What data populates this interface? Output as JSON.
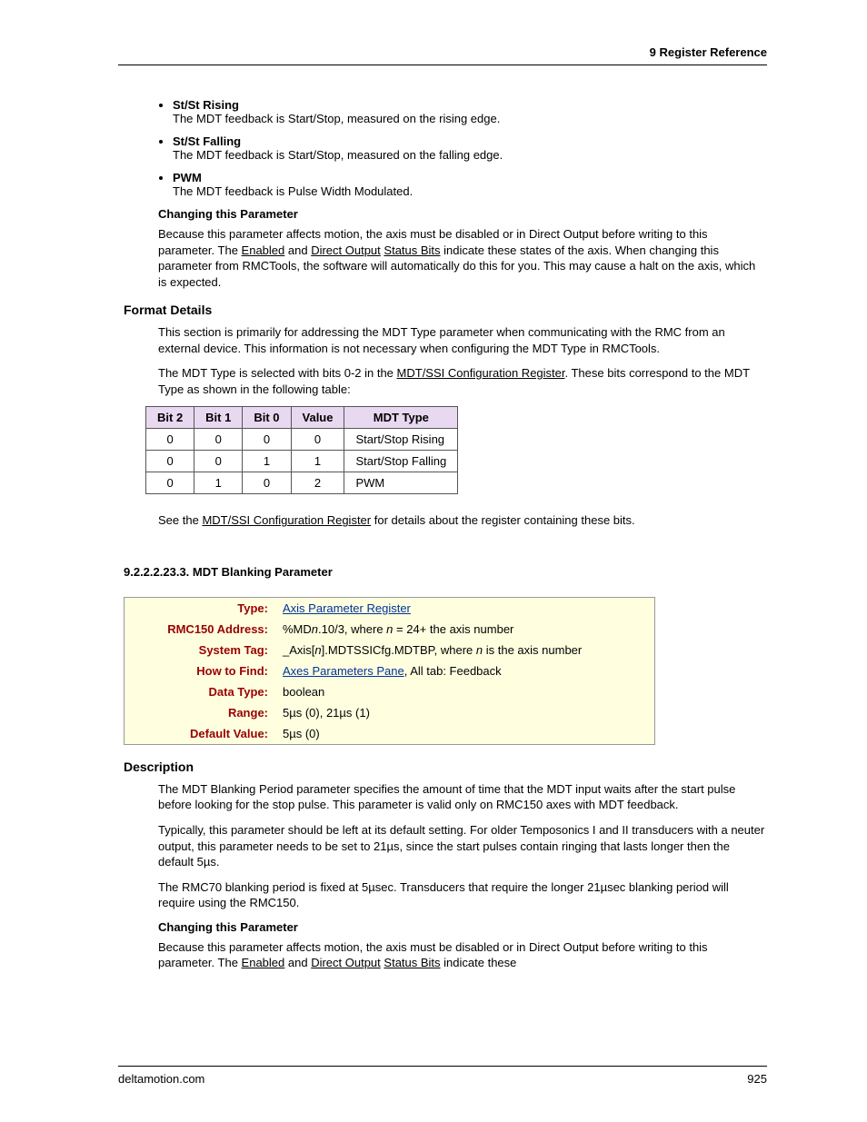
{
  "header": {
    "chapter": "9  Register Reference"
  },
  "bullets": [
    {
      "title": "St/St Rising",
      "desc": "The MDT feedback is Start/Stop, measured on the rising edge."
    },
    {
      "title": "St/St Falling",
      "desc": "The MDT feedback is Start/Stop, measured on the falling edge."
    },
    {
      "title": "PWM",
      "desc": "The MDT feedback is Pulse Width Modulated."
    }
  ],
  "changing_heading": "Changing this Parameter",
  "changing_para_pre": "Because this parameter affects motion, the axis must be disabled or in Direct Output before writing to this parameter. The ",
  "link_enabled": "Enabled",
  "txt_and": " and ",
  "link_direct_output": "Direct Output",
  "txt_space": " ",
  "link_status_bits": "Status Bits",
  "changing_para_post": " indicate these states of the axis. When changing this parameter from RMCTools, the software will automatically do this for you. This may cause a halt on the axis, which is expected.",
  "format_details_heading": "Format Details",
  "format_para1": "This section is primarily for addressing the MDT Type parameter when communicating with the RMC from an external device. This information is not necessary when configuring the MDT Type in RMCTools.",
  "format_para2_pre": "The MDT Type is selected with bits 0-2 in the ",
  "link_mdtssi_cfg": "MDT/SSI Configuration Register",
  "format_para2_post": ". These bits correspond to the MDT Type as shown in the following table:",
  "table_headers": {
    "c0": "Bit 2",
    "c1": "Bit 1",
    "c2": "Bit 0",
    "c3": "Value",
    "c4": "MDT Type"
  },
  "table_rows": [
    {
      "b2": "0",
      "b1": "0",
      "b0": "0",
      "val": "0",
      "type": "Start/Stop Rising"
    },
    {
      "b2": "0",
      "b1": "0",
      "b0": "1",
      "val": "1",
      "type": "Start/Stop Falling"
    },
    {
      "b2": "0",
      "b1": "1",
      "b0": "0",
      "val": "2",
      "type": "PWM"
    }
  ],
  "see_pre": "See the ",
  "see_post": " for details about the register containing these bits.",
  "sec_num": "9.2.2.2.23.3. MDT Blanking Parameter",
  "info": {
    "type_label": "Type:",
    "type_link": "Axis Parameter Register",
    "rmc150_label": "RMC150 Address:",
    "rmc150_pre": "%MD",
    "rmc150_n": "n",
    "rmc150_mid": ".10/3, where ",
    "rmc150_n2": "n",
    "rmc150_post": " = 24+ the axis number",
    "systag_label": "System Tag:",
    "systag_pre": "_Axis[",
    "systag_n": "n",
    "systag_mid": "].MDTSSICfg.MDTBP, where ",
    "systag_n2": "n",
    "systag_post": " is the axis number",
    "howto_label": "How to Find:",
    "howto_link": "Axes Parameters Pane",
    "howto_post": ", All tab: Feedback",
    "datatype_label": "Data Type:",
    "datatype_val": "boolean",
    "range_label": "Range:",
    "range_val": "5µs (0), 21µs (1)",
    "default_label": "Default Value:",
    "default_val": "5µs (0)"
  },
  "desc_heading": "Description",
  "desc_p1": "The MDT Blanking Period parameter specifies the amount of time that the MDT input waits after the start pulse before looking for the stop pulse. This parameter is valid only on RMC150 axes with MDT feedback.",
  "desc_p2": "Typically, this parameter should be left at its default setting. For older Temposonics I and II transducers with a neuter output, this parameter needs to be set to 21µs, since the start pulses contain ringing that lasts longer then the default 5µs.",
  "desc_p3": "The RMC70 blanking period is fixed at 5µsec. Transducers that require the longer 21µsec blanking period will require using the RMC150.",
  "changing2_post": " indicate these",
  "footer": {
    "site": "deltamotion.com",
    "page": "925"
  }
}
